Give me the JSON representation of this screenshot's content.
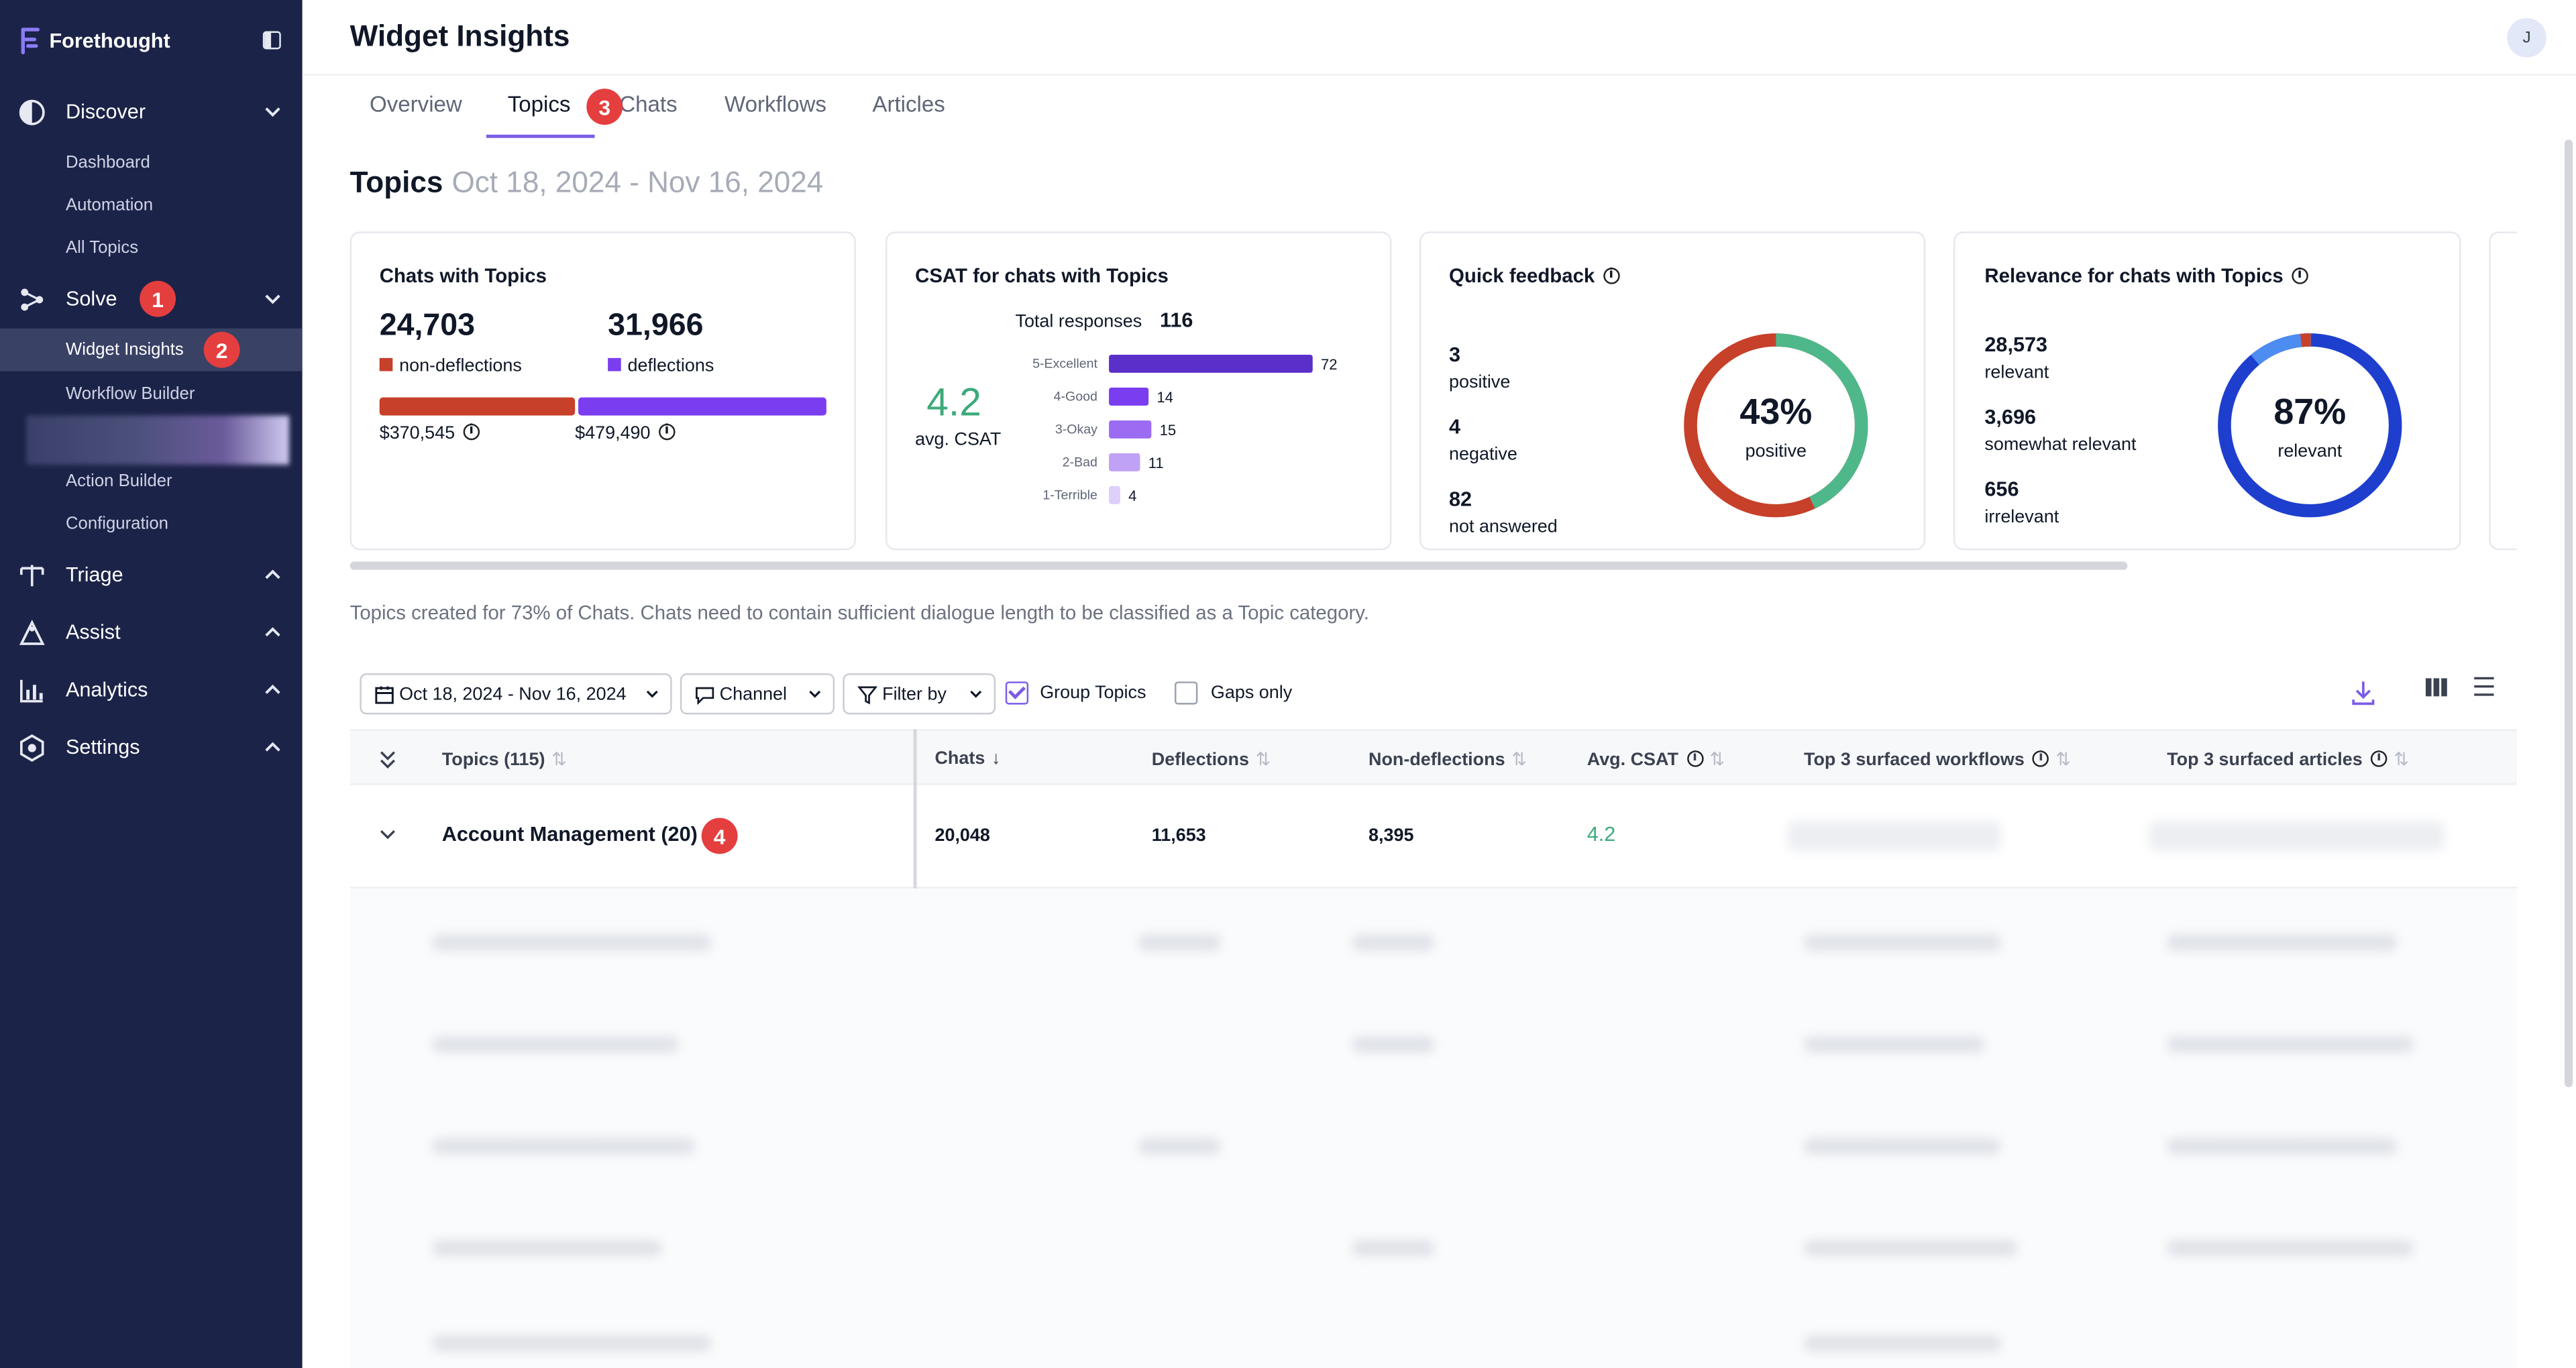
{
  "app": {
    "brand": "Forethought",
    "page_title": "Widget Insights",
    "avatar_initial": "J"
  },
  "sidebar": {
    "sections": [
      {
        "label": "Discover",
        "icon": "discover-icon",
        "items": [
          "Dashboard",
          "Automation",
          "All Topics"
        ]
      },
      {
        "label": "Solve",
        "icon": "solve-icon",
        "items": [
          "Widget Insights",
          "Workflow Builder",
          "Action Builder",
          "Configuration"
        ],
        "active_item": "Widget Insights"
      },
      {
        "label": "Triage",
        "icon": "triage-icon"
      },
      {
        "label": "Assist",
        "icon": "assist-icon"
      },
      {
        "label": "Analytics",
        "icon": "analytics-icon"
      },
      {
        "label": "Settings",
        "icon": "settings-icon"
      }
    ]
  },
  "badges": [
    "1",
    "2",
    "3",
    "4"
  ],
  "tabs": [
    "Overview",
    "Topics",
    "Chats",
    "Workflows",
    "Articles"
  ],
  "active_tab": "Topics",
  "section": {
    "title": "Topics",
    "date_range": "Oct 18, 2024 - Nov 16, 2024"
  },
  "cards": {
    "chats": {
      "title": "Chats with Topics",
      "nondeflections_value": "24,703",
      "nondeflections_label": "non-deflections",
      "deflections_value": "31,966",
      "deflections_label": "deflections",
      "nondeflections_cost": "$370,545",
      "deflections_cost": "$479,490",
      "split_fraction": 0.436
    },
    "csat": {
      "title": "CSAT for chats with Topics",
      "total_label": "Total responses",
      "total": "116",
      "avg": "4.2",
      "avg_label": "avg. CSAT",
      "ratings": [
        {
          "label": "5-Excellent",
          "value": 72
        },
        {
          "label": "4-Good",
          "value": 14
        },
        {
          "label": "3-Okay",
          "value": 15
        },
        {
          "label": "2-Bad",
          "value": 11
        },
        {
          "label": "1-Terrible",
          "value": 4
        }
      ]
    },
    "feedback": {
      "title": "Quick feedback",
      "positive_value": "3",
      "positive_label": "positive",
      "negative_value": "4",
      "negative_label": "negative",
      "unanswered_value": "82",
      "unanswered_label": "not answered",
      "donut_pct": "43%",
      "donut_label": "positive",
      "positive_fraction": 0.43
    },
    "relevance": {
      "title": "Relevance for chats with Topics",
      "relevant_value": "28,573",
      "relevant_label": "relevant",
      "somewhat_value": "3,696",
      "somewhat_label": "somewhat relevant",
      "irrelevant_value": "656",
      "irrelevant_label": "irrelevant",
      "donut_pct": "87%",
      "donut_label": "relevant"
    }
  },
  "note": "Topics created for 73% of Chats. Chats need to contain sufficient dialogue length to be classified as a Topic category.",
  "filters": {
    "date": "Oct 18, 2024 - Nov 16, 2024",
    "channel": "Channel",
    "filter_by": "Filter by",
    "group_topics": "Group Topics",
    "gaps_only": "Gaps only"
  },
  "table": {
    "columns": [
      "Topics (115)",
      "Chats",
      "Deflections",
      "Non-deflections",
      "Avg. CSAT",
      "Top 3 surfaced workflows",
      "Top 3 surfaced articles"
    ],
    "rows": [
      {
        "topic": "Account Management (20)",
        "chats": "20,048",
        "deflections": "11,653",
        "nondeflections": "8,395",
        "csat": "4.2"
      }
    ]
  },
  "colors": {
    "sidebar": "#1c2348",
    "accent": "#7b5ce6",
    "nondeflection": "#c7402a",
    "deflection": "#7b3df0",
    "csat_green": "#3daa7a",
    "relevance_blue": "#1e3fce"
  }
}
